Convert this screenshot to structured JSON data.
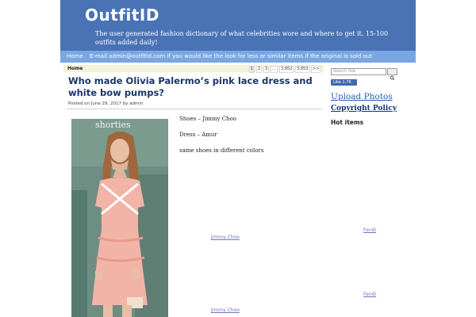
{
  "site": {
    "title": "OutfitID",
    "tagline": "The user generated fashion dictionary of what celebrities wore and where to get it. 15-100 outfits added daily!"
  },
  "nav": {
    "home": "Home",
    "email": "E-mail admin@outfitid.com if you would like the look for less or similar items if the original is sold out"
  },
  "breadcrumb": {
    "home": "Home"
  },
  "pagination": [
    "1",
    "2",
    "3",
    "...",
    "3,952",
    "3,953",
    ">>"
  ],
  "post": {
    "title": "Who made Olivia Palermo’s pink lace dress and white bow pumps?",
    "meta": "Posted on June 29, 2017 by admin",
    "photo_banner": "shorties",
    "lines": [
      "Shoes – Jimmy Choo",
      "Dress – Amur",
      "same shoes in different colors"
    ],
    "links": [
      "Jimmy Choo",
      "Fendi",
      "Jimmy Choo",
      "Fendi"
    ]
  },
  "sidebar": {
    "search_placeholder": "Search Site",
    "like_label": "Like 1.7K",
    "upload": "Upload Photos",
    "copyright": "Copyright Policy",
    "hot": "Hot items"
  }
}
